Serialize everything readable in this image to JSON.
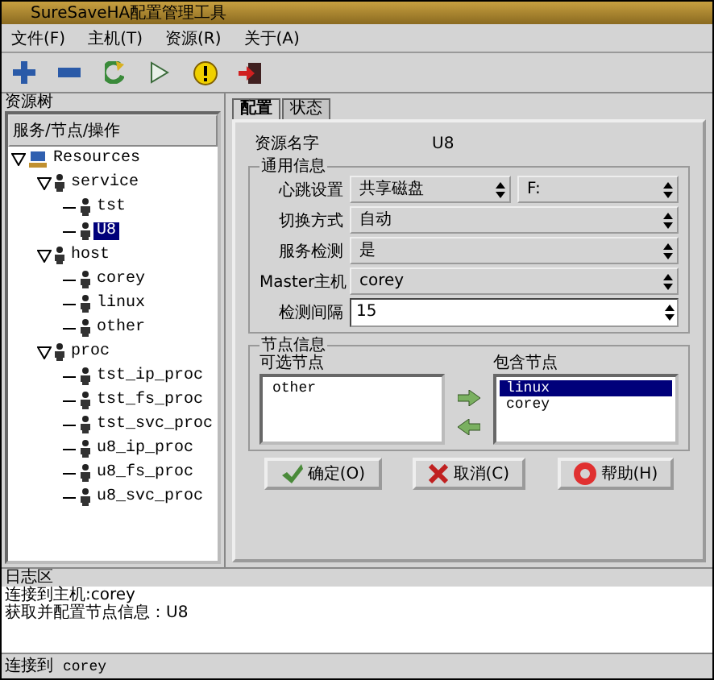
{
  "window": {
    "title": "SureSaveHA配置管理工具"
  },
  "menu": [
    "文件(F)",
    "主机(T)",
    "资源(R)",
    "关于(A)"
  ],
  "toolbar": [
    {
      "kind": "add"
    },
    {
      "kind": "remove"
    },
    {
      "kind": "refresh"
    },
    {
      "kind": "run"
    },
    {
      "kind": "warning"
    },
    {
      "kind": "exit"
    }
  ],
  "tree_panel": {
    "title": "资源树",
    "header": "服务/节点/操作",
    "items": [
      {
        "label": "Resources",
        "kind": "root",
        "expanded": true,
        "selected": false,
        "children": [
          {
            "label": "service",
            "kind": "node",
            "expanded": true,
            "selected": false,
            "children": [
              {
                "label": "tst",
                "kind": "node",
                "selected": false
              },
              {
                "label": "U8",
                "kind": "node",
                "selected": true
              }
            ]
          },
          {
            "label": "host",
            "kind": "node",
            "expanded": true,
            "selected": false,
            "children": [
              {
                "label": "corey",
                "kind": "node",
                "selected": false
              },
              {
                "label": "linux",
                "kind": "node",
                "selected": false
              },
              {
                "label": "other",
                "kind": "node",
                "selected": false
              }
            ]
          },
          {
            "label": "proc",
            "kind": "node",
            "expanded": true,
            "selected": false,
            "children": [
              {
                "label": "tst_ip_proc",
                "kind": "node",
                "selected": false
              },
              {
                "label": "tst_fs_proc",
                "kind": "node",
                "selected": false
              },
              {
                "label": "tst_svc_proc",
                "kind": "node",
                "selected": false
              },
              {
                "label": "u8_ip_proc",
                "kind": "node",
                "selected": false
              },
              {
                "label": "u8_fs_proc",
                "kind": "node",
                "selected": false
              },
              {
                "label": "u8_svc_proc",
                "kind": "node",
                "selected": false
              }
            ]
          }
        ]
      }
    ]
  },
  "tabs": [
    {
      "label": "配置",
      "selected": true
    },
    {
      "label": "状态",
      "selected": false
    }
  ],
  "resource_name": {
    "label": "资源名字",
    "value": "U8"
  },
  "general": {
    "title": "通用信息",
    "rows": [
      {
        "label": "心跳设置",
        "kind": "double",
        "values": [
          "共享磁盘",
          "F:"
        ]
      },
      {
        "label": "切换方式",
        "kind": "select",
        "values": [
          "自动"
        ]
      },
      {
        "label": "服务检测",
        "kind": "select",
        "values": [
          "是"
        ]
      },
      {
        "label": "Master主机",
        "kind": "select",
        "values": [
          "corey"
        ]
      },
      {
        "label": "检测间隔",
        "kind": "spin",
        "values": [
          "15"
        ]
      }
    ]
  },
  "nodes": {
    "title": "节点信息",
    "available_label": "可选节点",
    "available": [
      {
        "label": "other",
        "selected": false
      }
    ],
    "included_label": "包含节点",
    "included": [
      {
        "label": "linux",
        "selected": true
      },
      {
        "label": "corey",
        "selected": false
      }
    ]
  },
  "buttons": [
    {
      "label": "确定(O)",
      "kind": "ok"
    },
    {
      "label": "取消(C)",
      "kind": "cancel"
    },
    {
      "label": "帮助(H)",
      "kind": "help"
    }
  ],
  "log": {
    "title": "日志区",
    "lines": [
      "连接到主机:corey",
      "获取并配置节点信息：U8"
    ]
  },
  "status_bar": {
    "label": "连接到",
    "value": "corey"
  }
}
